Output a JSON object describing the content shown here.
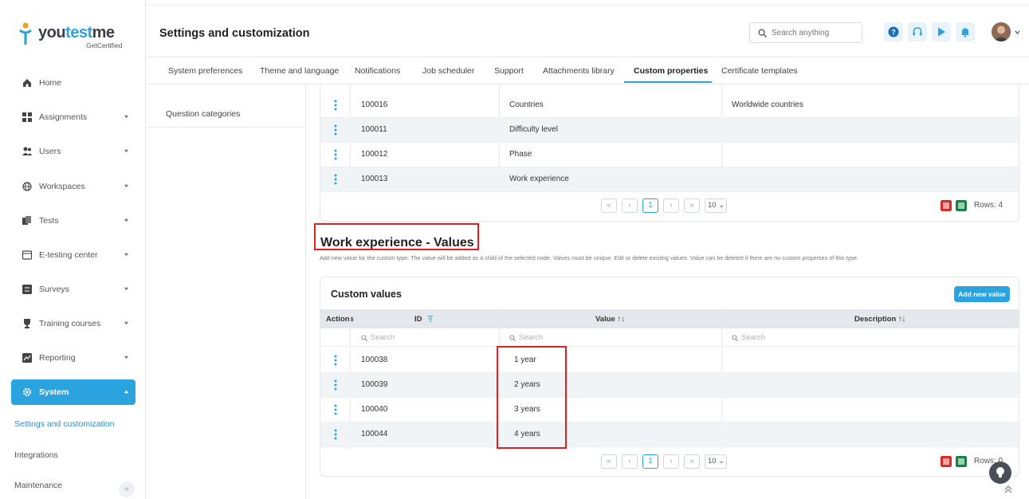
{
  "app": {
    "logo_prefix": "you",
    "logo_accent": "test",
    "logo_suffix": "me",
    "logo_sub": "GetCertified",
    "accent_color": "#2aa3df"
  },
  "sidebar": {
    "items": [
      {
        "label": "Home",
        "icon": "home-icon"
      },
      {
        "label": "Assignments",
        "icon": "assignments-icon"
      },
      {
        "label": "Users",
        "icon": "users-icon"
      },
      {
        "label": "Workspaces",
        "icon": "globe-icon"
      },
      {
        "label": "Tests",
        "icon": "tests-icon"
      },
      {
        "label": "E-testing center",
        "icon": "monitor-icon"
      },
      {
        "label": "Surveys",
        "icon": "survey-icon"
      },
      {
        "label": "Training courses",
        "icon": "trophy-icon"
      },
      {
        "label": "Reporting",
        "icon": "report-icon"
      },
      {
        "label": "System",
        "icon": "gear-icon"
      }
    ],
    "sub_items": [
      "Settings and customization",
      "Integrations",
      "Maintenance"
    ],
    "collapse_glyph": "«"
  },
  "header": {
    "title": "Settings and customization",
    "search_placeholder": "Search anything"
  },
  "tabs": [
    "System preferences",
    "Theme and language",
    "Notifications",
    "Job scheduler",
    "Support",
    "Attachments library",
    "Custom properties",
    "Certificate templates"
  ],
  "left_pane": {
    "items": [
      "Question categories"
    ]
  },
  "types_table": {
    "rows": [
      {
        "id": "100016",
        "name": "Countries",
        "description": "Worldwide countries"
      },
      {
        "id": "100011",
        "name": "Difficulty level",
        "description": ""
      },
      {
        "id": "100012",
        "name": "Phase",
        "description": ""
      },
      {
        "id": "100013",
        "name": "Work experience",
        "description": ""
      }
    ],
    "pager": {
      "first": "«",
      "prev": "‹",
      "page": "1",
      "next": "›",
      "last": "»",
      "per_page": "10 ⌄"
    },
    "rows_label": "Rows: 4"
  },
  "values_section": {
    "title": "Work experience - Values",
    "description": "Add new value for the custom type. The value will be added as a child of the selected node. Values must be unique. Edit or delete existing values. Value can be deleted if there are no custom properties of this type."
  },
  "values_table": {
    "title": "Custom values",
    "add_button": "Add new value",
    "columns": {
      "actions": "Actions",
      "id": "ID",
      "value": "Value ↑↓",
      "description": "Description ↑↓"
    },
    "filter_placeholder": "Search",
    "rows": [
      {
        "id": "100038",
        "value": "1 year"
      },
      {
        "id": "100039",
        "value": "2 years"
      },
      {
        "id": "100040",
        "value": "3 years"
      },
      {
        "id": "100044",
        "value": "4 years"
      }
    ],
    "pager": {
      "first": "«",
      "prev": "‹",
      "page": "1",
      "next": "›",
      "last": "»",
      "per_page": "10 ⌄"
    },
    "rows_label": "Rows: 0"
  }
}
